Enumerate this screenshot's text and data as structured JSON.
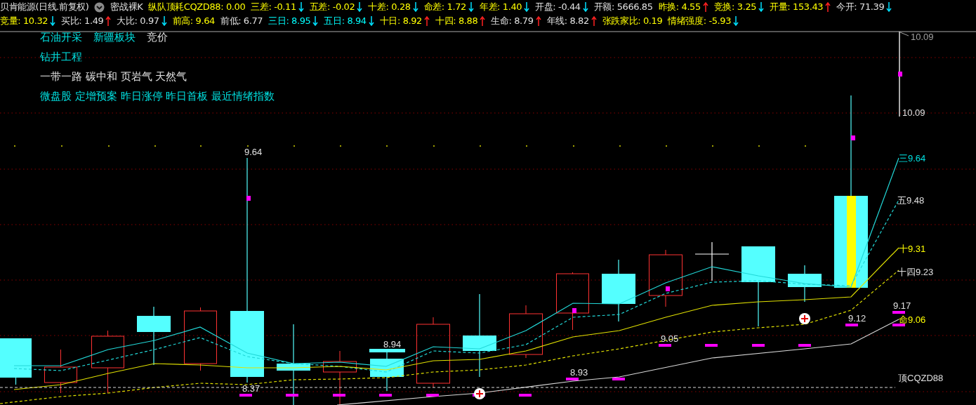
{
  "header": {
    "title": "贝肯能源(日线.前复权)",
    "indicator": "密战裸K",
    "line1": [
      {
        "text": "纵队顶耗CQZD88: 0.00",
        "color": "#ffff00",
        "arrow_up": false,
        "arrow_down": false
      },
      {
        "text": "三差: -0.11",
        "color": "#ffff00",
        "arrow_up": false,
        "arrow_down": true
      },
      {
        "text": "五差: -0.02",
        "color": "#ffff00",
        "arrow_up": false,
        "arrow_down": true
      },
      {
        "text": "十差: 0.28",
        "color": "#ffff00",
        "arrow_up": false,
        "arrow_down": true
      },
      {
        "text": "命差: 1.72",
        "color": "#ffff00",
        "arrow_up": false,
        "arrow_down": true
      },
      {
        "text": "年差: 1.40",
        "color": "#ffff00",
        "arrow_up": false,
        "arrow_down": true
      },
      {
        "text": "开盘: -0.44",
        "color": "#e0e0e0",
        "arrow_up": false,
        "arrow_down": true
      },
      {
        "text": "开额: 5666.85",
        "color": "#e0e0e0",
        "arrow_up": false,
        "arrow_down": false
      },
      {
        "text": "昨换: 4.55",
        "color": "#ffff00",
        "arrow_up": true,
        "arrow_down": false
      },
      {
        "text": "竞换: 3.25",
        "color": "#ffff00",
        "arrow_up": false,
        "arrow_down": true
      },
      {
        "text": "开量: 153.43",
        "color": "#ffff00",
        "arrow_up": true,
        "arrow_down": false
      },
      {
        "text": "今开: 71.39",
        "color": "#e0e0e0",
        "arrow_up": false,
        "arrow_down": true
      }
    ],
    "line2": [
      {
        "text": "竞量: 10.32",
        "color": "#ffff00",
        "arrow_up": false,
        "arrow_down": true
      },
      {
        "text": "买比: 1.49",
        "color": "#e0e0e0",
        "arrow_up": true,
        "arrow_down": false
      },
      {
        "text": "大比: 0.97",
        "color": "#e0e0e0",
        "arrow_up": false,
        "arrow_down": true
      },
      {
        "text": "前高: 9.64",
        "color": "#ffff00",
        "arrow_up": false,
        "arrow_down": false
      },
      {
        "text": "前低: 6.77",
        "color": "#e0e0e0",
        "arrow_up": false,
        "arrow_down": false
      },
      {
        "text": "三日: 8.95",
        "color": "#00ffff",
        "arrow_up": false,
        "arrow_down": true
      },
      {
        "text": "五日: 8.94",
        "color": "#00ffff",
        "arrow_up": false,
        "arrow_down": true
      },
      {
        "text": "十日: 8.92",
        "color": "#ffff00",
        "arrow_up": true,
        "arrow_down": false
      },
      {
        "text": "十四: 8.88",
        "color": "#ffff00",
        "arrow_up": true,
        "arrow_down": false
      },
      {
        "text": "生命: 8.79",
        "color": "#e0e0e0",
        "arrow_up": true,
        "arrow_down": false
      },
      {
        "text": "年线: 8.82",
        "color": "#e0e0e0",
        "arrow_up": true,
        "arrow_down": false
      },
      {
        "text": "张跌家比: 0.19",
        "color": "#ffff00",
        "arrow_up": false,
        "arrow_down": false
      },
      {
        "text": "情绪强度: -5.93",
        "color": "#ffff00",
        "arrow_up": false,
        "arrow_down": true
      }
    ]
  },
  "tags": [
    [
      {
        "text": "石油开采",
        "color": "#00e0e0"
      },
      {
        "text": "新疆板块",
        "color": "#00e0e0"
      },
      {
        "text": "竞价",
        "color": "#e0e0e0"
      }
    ],
    [
      {
        "text": "钻井工程",
        "color": "#00e0e0"
      }
    ],
    [
      {
        "text": "一带一路 碳中和 页岩气 天然气",
        "color": "#e0e0e0"
      }
    ],
    [
      {
        "text": "微盘股 定增预案 昨日涨停 昨日首板 最近情绪指数",
        "color": "#00e0e0"
      }
    ]
  ],
  "chart": {
    "labels": [
      {
        "text": "10.09",
        "color": "#a0a0a0"
      },
      {
        "text": "10.09",
        "color": "#e0e0e0"
      },
      {
        "text": "三9.64",
        "color": "#00e0e0"
      },
      {
        "text": "五9.48",
        "color": "#e0e0e0"
      },
      {
        "text": "十9.31",
        "color": "#ffff00"
      },
      {
        "text": "十四9.23",
        "color": "#e0e0e0"
      },
      {
        "text": "9.17",
        "color": "#e0e0e0"
      },
      {
        "text": "命9.06",
        "color": "#ffff00"
      },
      {
        "text": "顶CQZD88",
        "color": "#e0e0e0"
      },
      {
        "text": "9.64",
        "color": "#e0e0e0"
      },
      {
        "text": "8.94",
        "color": "#e0e0e0"
      },
      {
        "text": "8.37",
        "color": "#e0e0e0"
      },
      {
        "text": "8.93",
        "color": "#e0e0e0"
      },
      {
        "text": "9.05",
        "color": "#e0e0e0"
      },
      {
        "text": "9.12",
        "color": "#e0e0e0"
      }
    ]
  }
}
